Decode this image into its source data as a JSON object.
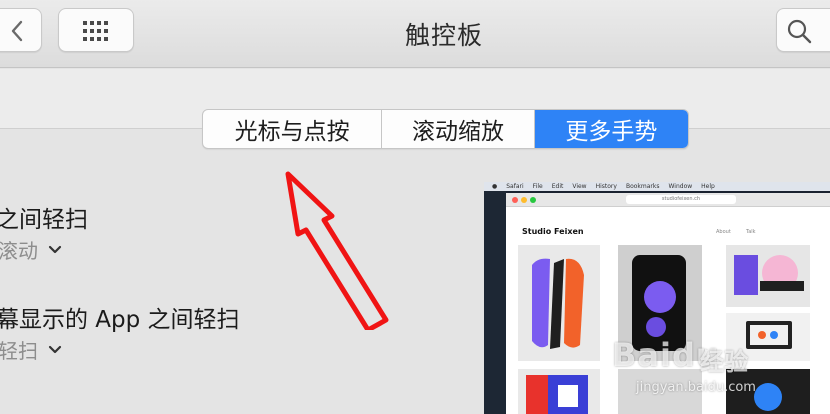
{
  "toolbar": {
    "title": "触控板",
    "icons": {
      "back": "chevron-left-icon",
      "grid": "grid-icon",
      "search": "search-icon"
    }
  },
  "tabs": [
    {
      "label": "光标与点按",
      "selected": false
    },
    {
      "label": "滚动缩放",
      "selected": false
    },
    {
      "label": "更多手势",
      "selected": true
    }
  ],
  "settings": [
    {
      "title": "之间轻扫",
      "value": "滚动"
    },
    {
      "title": "幕显示的 App 之间轻扫",
      "value": "轻扫"
    }
  ],
  "preview": {
    "menubar": [
      "Safari",
      "File",
      "Edit",
      "View",
      "History",
      "Bookmarks",
      "Window",
      "Help"
    ],
    "url": "studiofeixen.ch",
    "site_title": "Studio Feixen",
    "nav": [
      "About",
      "Talk"
    ]
  },
  "watermark": {
    "brand": "Baidu",
    "cn": "经验",
    "url": "jingyan.baidu.com"
  },
  "colors": {
    "accent": "#2e83f6",
    "arrow": "#f01414"
  }
}
